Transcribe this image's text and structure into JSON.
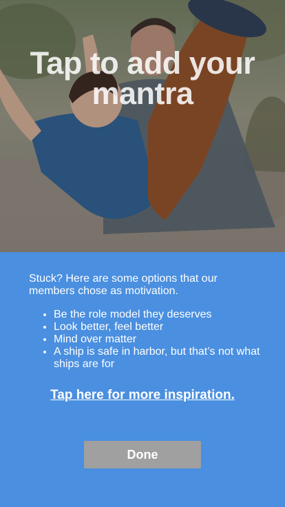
{
  "mantra": {
    "title": "Tap to add your mantra"
  },
  "hero_image": {
    "icon": "family-photo"
  },
  "suggestions": {
    "intro": "Stuck? Here are some options that our members chose as motivation.",
    "options": [
      "Be the role model they deserves",
      "Look better, feel better",
      "Mind over matter",
      "A ship is safe in harbor, but that’s not what ships are for"
    ],
    "inspiration_link": "Tap here for more inspiration."
  },
  "actions": {
    "done_label": "Done"
  },
  "colors": {
    "panel_background": "#4a8fe0",
    "button_background": "#a0a0a0",
    "text": "#ffffff"
  }
}
